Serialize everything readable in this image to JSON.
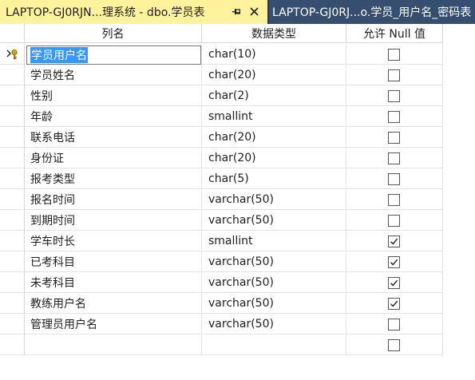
{
  "tabs": [
    {
      "label": "LAPTOP-GJ0RJN...理系统 - dbo.学员表",
      "active": true
    },
    {
      "label": "LAPTOP-GJ0RJ...o.学员_用户名_密码表",
      "active": false
    }
  ],
  "columns": {
    "name": "列名",
    "type": "数据类型",
    "null": "允许 Null 值"
  },
  "rows": [
    {
      "name": "学员用户名",
      "type": "char(10)",
      "allow_null": false,
      "primary_key": true,
      "editing": true
    },
    {
      "name": "学员姓名",
      "type": "char(20)",
      "allow_null": false
    },
    {
      "name": "性别",
      "type": "char(2)",
      "allow_null": false
    },
    {
      "name": "年龄",
      "type": "smallint",
      "allow_null": false
    },
    {
      "name": "联系电话",
      "type": "char(20)",
      "allow_null": false
    },
    {
      "name": "身份证",
      "type": "char(20)",
      "allow_null": false
    },
    {
      "name": "报考类型",
      "type": "char(5)",
      "allow_null": false
    },
    {
      "name": "报名时间",
      "type": "varchar(50)",
      "allow_null": false
    },
    {
      "name": "到期时间",
      "type": "varchar(50)",
      "allow_null": false
    },
    {
      "name": "学车时长",
      "type": "smallint",
      "allow_null": true
    },
    {
      "name": "已考科目",
      "type": "varchar(50)",
      "allow_null": true
    },
    {
      "name": "未考科目",
      "type": "varchar(50)",
      "allow_null": true
    },
    {
      "name": "教练用户名",
      "type": "varchar(50)",
      "allow_null": true
    },
    {
      "name": "管理员用户名",
      "type": "varchar(50)",
      "allow_null": false
    },
    {
      "name": "",
      "type": "",
      "allow_null": false
    }
  ],
  "colors": {
    "tab_active_bg": "#fff29d",
    "tab_inactive_bg": "#364e6f",
    "tabstrip_bg": "#293955",
    "selection": "#3399ff"
  }
}
